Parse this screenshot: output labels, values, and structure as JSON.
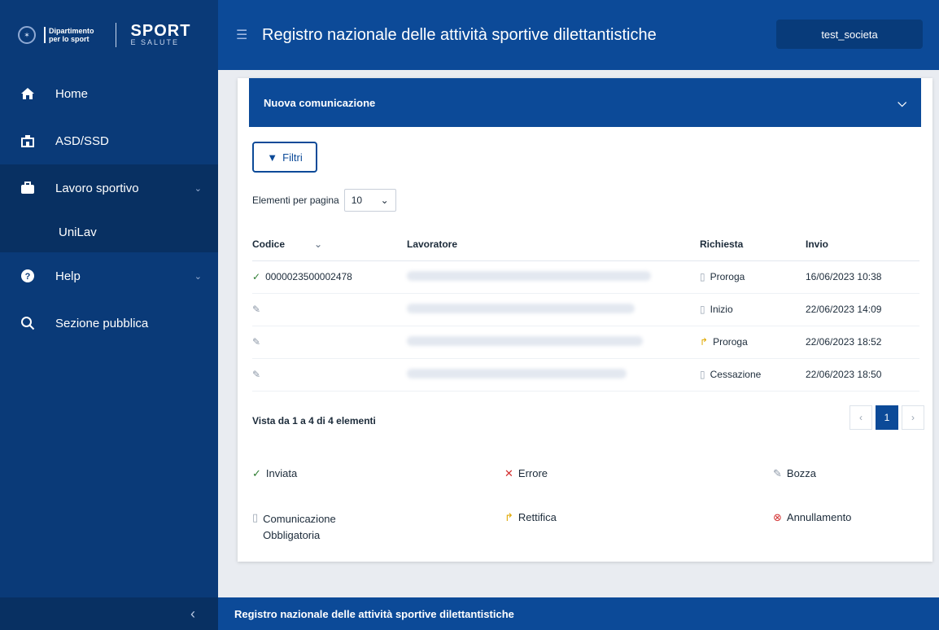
{
  "brand": {
    "dept_line1": "Dipartimento",
    "dept_line2": "per lo sport",
    "sport": "SPORT",
    "salute": "E SALUTE"
  },
  "sidebar": {
    "items": [
      {
        "label": "Home",
        "icon": "home-icon"
      },
      {
        "label": "ASD/SSD",
        "icon": "building-icon"
      },
      {
        "label": "Lavoro sportivo",
        "icon": "briefcase-icon"
      },
      {
        "label": "UniLav",
        "icon": ""
      },
      {
        "label": "Help",
        "icon": "help-icon"
      },
      {
        "label": "Sezione pubblica",
        "icon": "search-icon"
      }
    ],
    "collapse_glyph": "‹"
  },
  "header": {
    "title": "Registro nazionale delle attività sportive dilettantistiche",
    "user": "test_societa"
  },
  "accordion": {
    "label": "Nuova comunicazione"
  },
  "filters": {
    "button_label": "Filtri",
    "per_page_label": "Elementi per pagina",
    "per_page_value": "10"
  },
  "table": {
    "headers": [
      "Codice",
      "Lavoratore",
      "Richiesta",
      "Invio"
    ],
    "rows": [
      {
        "status": "Inviata",
        "codice": "0000023500002478",
        "richiesta": "Proroga",
        "richiesta_icon": "document-icon",
        "invio": "16/06/2023 10:38"
      },
      {
        "status": "Bozza",
        "codice": "",
        "richiesta": "Inizio",
        "richiesta_icon": "document-icon",
        "invio": "22/06/2023 14:09"
      },
      {
        "status": "Bozza",
        "codice": "",
        "richiesta": "Proroga",
        "richiesta_icon": "retry-icon",
        "invio": "22/06/2023 18:52"
      },
      {
        "status": "Bozza",
        "codice": "",
        "richiesta": "Cessazione",
        "richiesta_icon": "document-icon",
        "invio": "22/06/2023 18:50"
      }
    ]
  },
  "pagination": {
    "summary": "Vista da 1 a 4 di 4 elementi",
    "current": "1",
    "prev": "‹",
    "next": "›"
  },
  "legend": {
    "sent": "Inviata",
    "error": "Errore",
    "draft": "Bozza",
    "mandatory_line1": "Comunicazione",
    "mandatory_line2": "Obbligatoria",
    "correction": "Rettifica",
    "cancellation": "Annullamento"
  },
  "footer": {
    "text": "Registro nazionale delle attività sportive dilettantistiche"
  },
  "colors": {
    "primary": "#0c4a98",
    "sidebar": "#0a3a78",
    "success": "#2e7d32",
    "error": "#d32f2f",
    "warning": "#e0a800"
  }
}
